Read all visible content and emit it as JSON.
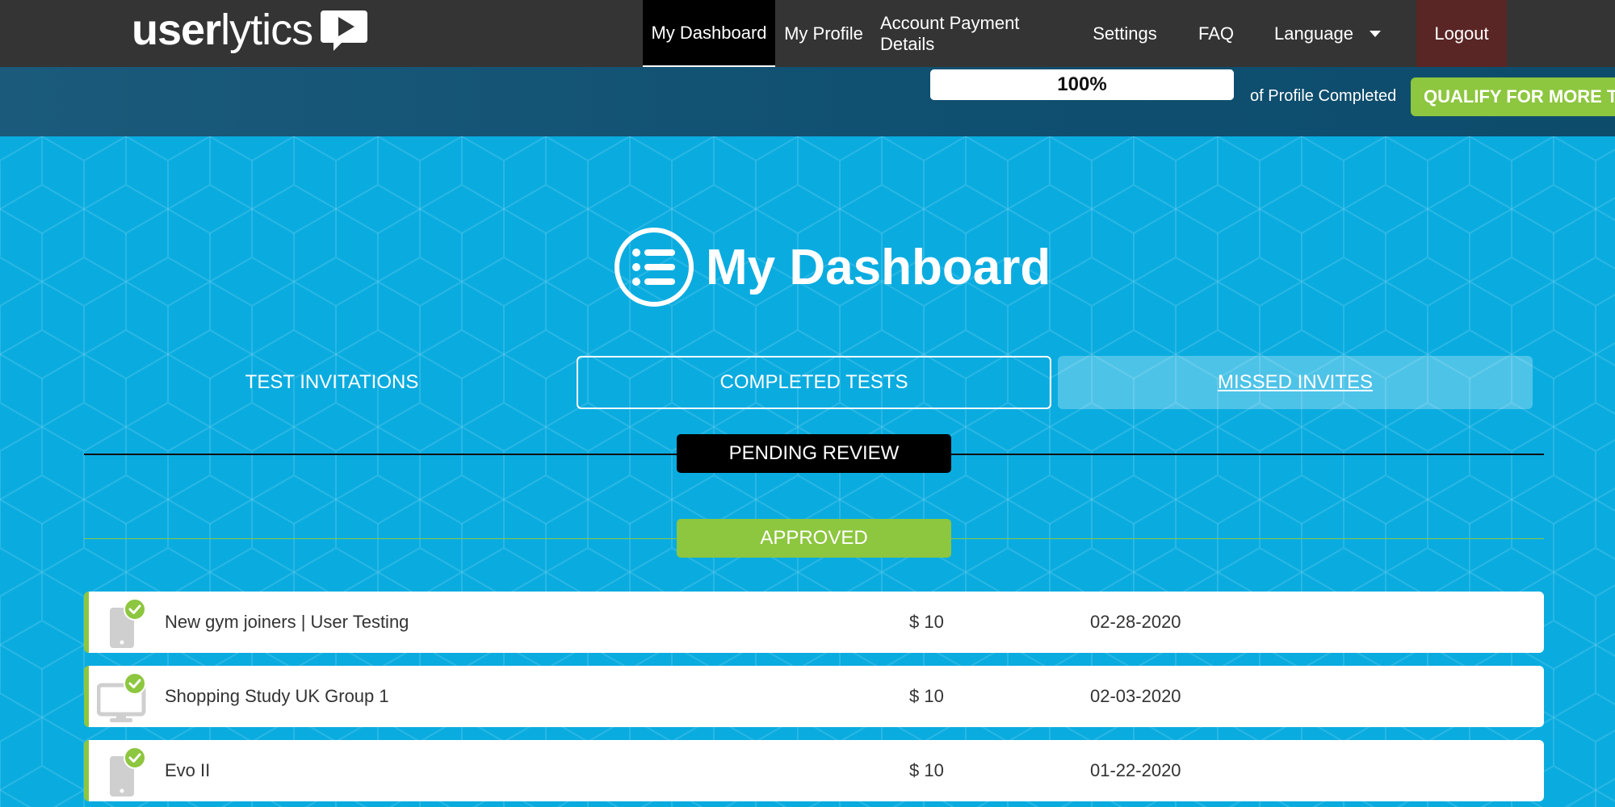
{
  "brand": {
    "logo_bold": "user",
    "logo_light": "lytics",
    "logo_icon": "play-icon"
  },
  "nav": {
    "items": [
      {
        "label": "My Dashboard",
        "active": true
      },
      {
        "label": "My Profile"
      },
      {
        "label": "Account Payment Details"
      },
      {
        "label": "Settings"
      },
      {
        "label": "FAQ"
      },
      {
        "label": "Language"
      },
      {
        "label": "Logout"
      }
    ]
  },
  "profile": {
    "progress_percent": 100,
    "progress_text": "100%",
    "completed_label": "of Profile Completed",
    "qualify_button": "QUALIFY FOR MORE TESTS"
  },
  "dashboard": {
    "title": "My Dashboard",
    "title_icon": "list-icon",
    "tabs": [
      {
        "label": "TEST INVITATIONS"
      },
      {
        "label": "COMPLETED TESTS",
        "selected": true
      },
      {
        "label": "MISSED INVITES"
      }
    ],
    "sections": {
      "pending": "PENDING REVIEW",
      "approved": "APPROVED"
    },
    "approved_rows": [
      {
        "device": "mobile-icon",
        "name": "New gym joiners | User Testing",
        "amount": "$ 10",
        "date": "02-28-2020"
      },
      {
        "device": "desktop-icon",
        "name": "Shopping Study UK Group 1",
        "amount": "$ 10",
        "date": "02-03-2020"
      },
      {
        "device": "mobile-icon",
        "name": "Evo II",
        "amount": "$ 10",
        "date": "01-22-2020"
      }
    ]
  },
  "colors": {
    "topbar": "#343434",
    "accent_green": "#8dc63f",
    "background_blue": "#0aace0",
    "strip": "#0f4f6f"
  }
}
